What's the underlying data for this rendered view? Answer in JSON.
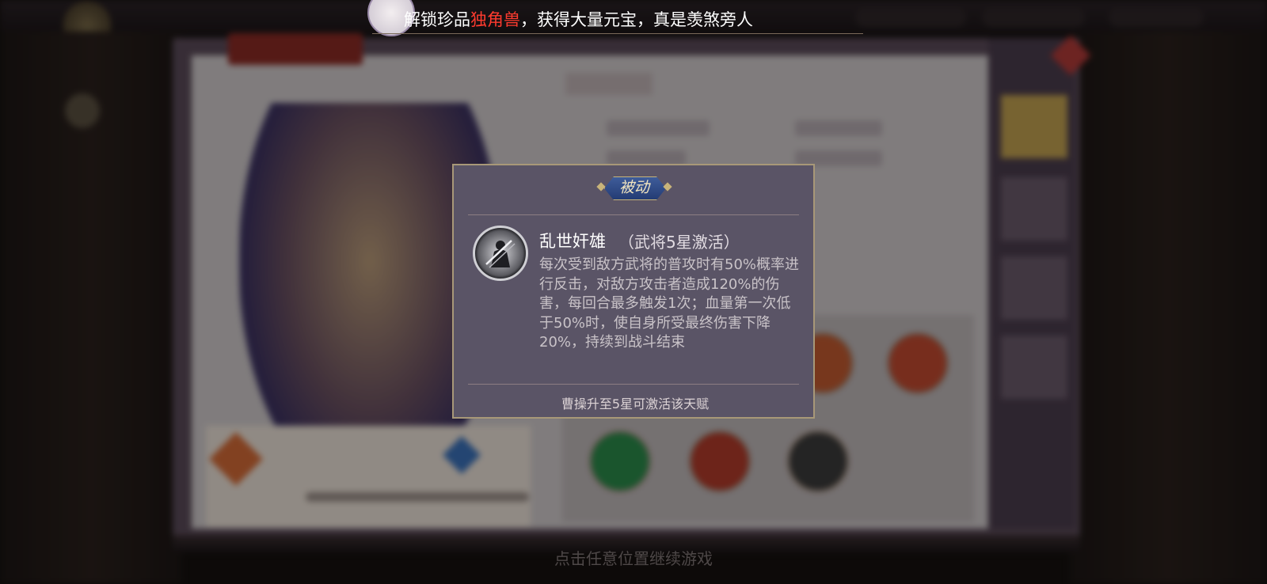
{
  "marquee": {
    "prefix": "解锁珍品",
    "highlight": "独角兽",
    "suffix": "，获得大量元宝，真是羡煞旁人"
  },
  "popup": {
    "badge": "被动",
    "skill_name": "乱世奸雄",
    "skill_condition": "（武将5星激活）",
    "skill_description": "每次受到敌方武将的普攻时有50%概率进行反击，对敌方攻击者造成120%的伤害，每回合最多触发1次；血量第一次低于50%时，使自身所受最终伤害下降20%，持续到战斗结束",
    "footer": "曹操升至5星可激活该天赋"
  },
  "continue_hint": "点击任意位置继续游戏",
  "colors": {
    "highlight": "#ff3b2f",
    "popup_bg": "#5a5466",
    "popup_border": "#a89878",
    "badge_blue": "#2f4c88"
  },
  "icons": {
    "skill_icon": "warrior-silhouette-icon",
    "chat": "chat-bubble-icon",
    "close": "close-icon"
  }
}
